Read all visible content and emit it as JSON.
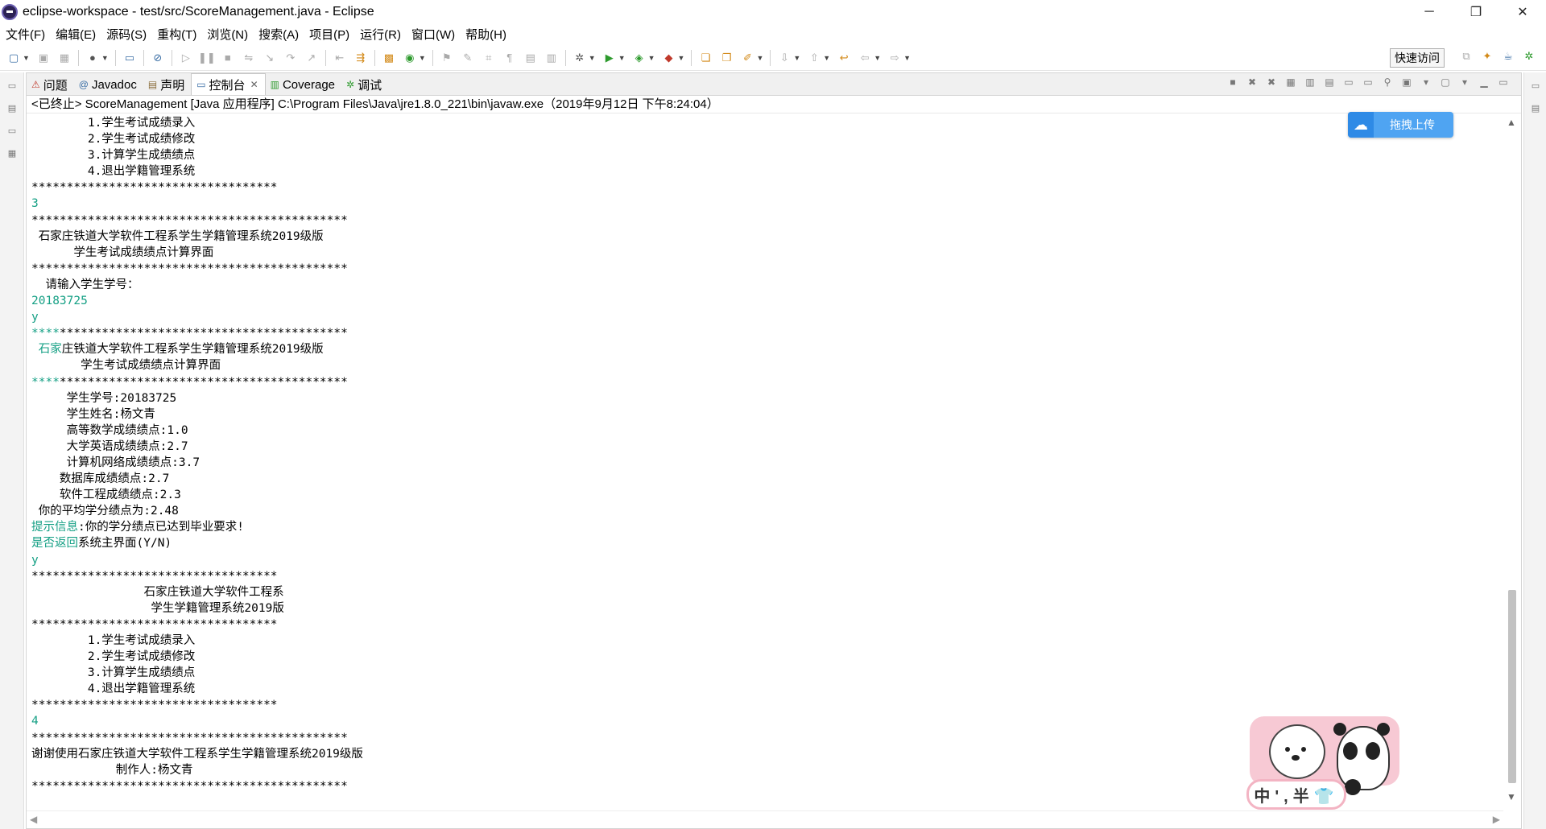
{
  "window": {
    "title": "eclipse-workspace - test/src/ScoreManagement.java - Eclipse",
    "minimize": "─",
    "restore": "❐",
    "close": "✕"
  },
  "menu": [
    "文件(F)",
    "编辑(E)",
    "源码(S)",
    "重构(T)",
    "浏览(N)",
    "搜索(A)",
    "项目(P)",
    "运行(R)",
    "窗口(W)",
    "帮助(H)"
  ],
  "toolbar": {
    "quick_access": "快速访问"
  },
  "tabs": [
    {
      "label": "问题",
      "icon": "problems-icon",
      "glyph": "⚠"
    },
    {
      "label": "Javadoc",
      "icon": "javadoc-icon",
      "glyph": "@"
    },
    {
      "label": "声明",
      "icon": "declaration-icon",
      "glyph": "▤"
    },
    {
      "label": "控制台",
      "icon": "console-icon",
      "glyph": "▭",
      "active": true
    },
    {
      "label": "Coverage",
      "icon": "coverage-icon",
      "glyph": "▥"
    },
    {
      "label": "调试",
      "icon": "debug-icon",
      "glyph": "✲"
    }
  ],
  "console": {
    "status": "<已终止> ScoreManagement [Java 应用程序] C:\\Program Files\\Java\\jre1.8.0_221\\bin\\javaw.exe（2019年9月12日 下午8:24:04）",
    "lines": [
      {
        "t": "        1.学生考试成绩录入"
      },
      {
        "t": "        2.学生考试成绩修改"
      },
      {
        "t": "        3.计算学生成绩绩点"
      },
      {
        "t": "        4.退出学籍管理系统"
      },
      {
        "t": "***********************************"
      },
      {
        "in": "3"
      },
      {
        "t": "*********************************************"
      },
      {
        "t": " 石家庄铁道大学软件工程系学生学籍管理系统2019级版"
      },
      {
        "t": "      学生考试成绩绩点计算界面"
      },
      {
        "t": "*********************************************"
      },
      {
        "t": "  请输入学生学号："
      },
      {
        "in": "20183725"
      },
      {
        "in": "y"
      },
      {
        "in": "****",
        "t": "*****************************************"
      },
      {
        "in": " 石家",
        "t": "庄铁道大学软件工程系学生学籍管理系统2019级版"
      },
      {
        "t": "       学生考试成绩绩点计算界面"
      },
      {
        "in": "****",
        "t": "*****************************************"
      },
      {
        "t": "     学生学号:20183725"
      },
      {
        "t": "     学生姓名:杨文青"
      },
      {
        "t": "     高等数学成绩绩点:1.0"
      },
      {
        "t": "     大学英语成绩绩点:2.7"
      },
      {
        "t": "     计算机网络成绩绩点:3.7"
      },
      {
        "t": "    数据库成绩绩点:2.7"
      },
      {
        "t": "    软件工程成绩绩点:2.3"
      },
      {
        "t": " 你的平均学分绩点为:2.48"
      },
      {
        "in": "提示信息",
        "t": ":你的学分绩点已达到毕业要求!"
      },
      {
        "in": "是否返回",
        "t": "系统主界面(Y/N)"
      },
      {
        "in": "y"
      },
      {
        "t": "***********************************"
      },
      {
        "t": "                石家庄铁道大学软件工程系"
      },
      {
        "t": "                 学生学籍管理系统2019版"
      },
      {
        "t": "***********************************"
      },
      {
        "t": "        1.学生考试成绩录入"
      },
      {
        "t": "        2.学生考试成绩修改"
      },
      {
        "t": "        3.计算学生成绩绩点"
      },
      {
        "t": "        4.退出学籍管理系统"
      },
      {
        "t": "***********************************"
      },
      {
        "in": "4"
      },
      {
        "t": "*********************************************"
      },
      {
        "t": "谢谢使用石家庄铁道大学软件工程系学生学籍管理系统2019级版"
      },
      {
        "t": "            制作人:杨文青"
      },
      {
        "t": "*********************************************"
      }
    ]
  },
  "overlay": {
    "upload_label": "拖拽上传",
    "ime_text": "中',半👕"
  }
}
